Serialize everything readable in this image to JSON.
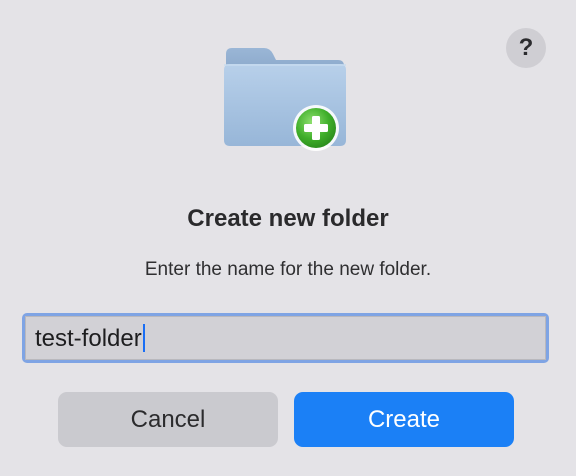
{
  "dialog": {
    "help_label": "?",
    "title": "Create new folder",
    "message": "Enter the name for the new folder.",
    "folder_name_value": "test-folder",
    "cancel_label": "Cancel",
    "create_label": "Create",
    "folder_icon": "new-folder-icon",
    "colors": {
      "background": "#e4e3e7",
      "accent": "#1b80f6",
      "focus_ring": "#7fa4e4",
      "folder": "#a9c4e0",
      "plus_badge": "#3fae2a"
    }
  }
}
